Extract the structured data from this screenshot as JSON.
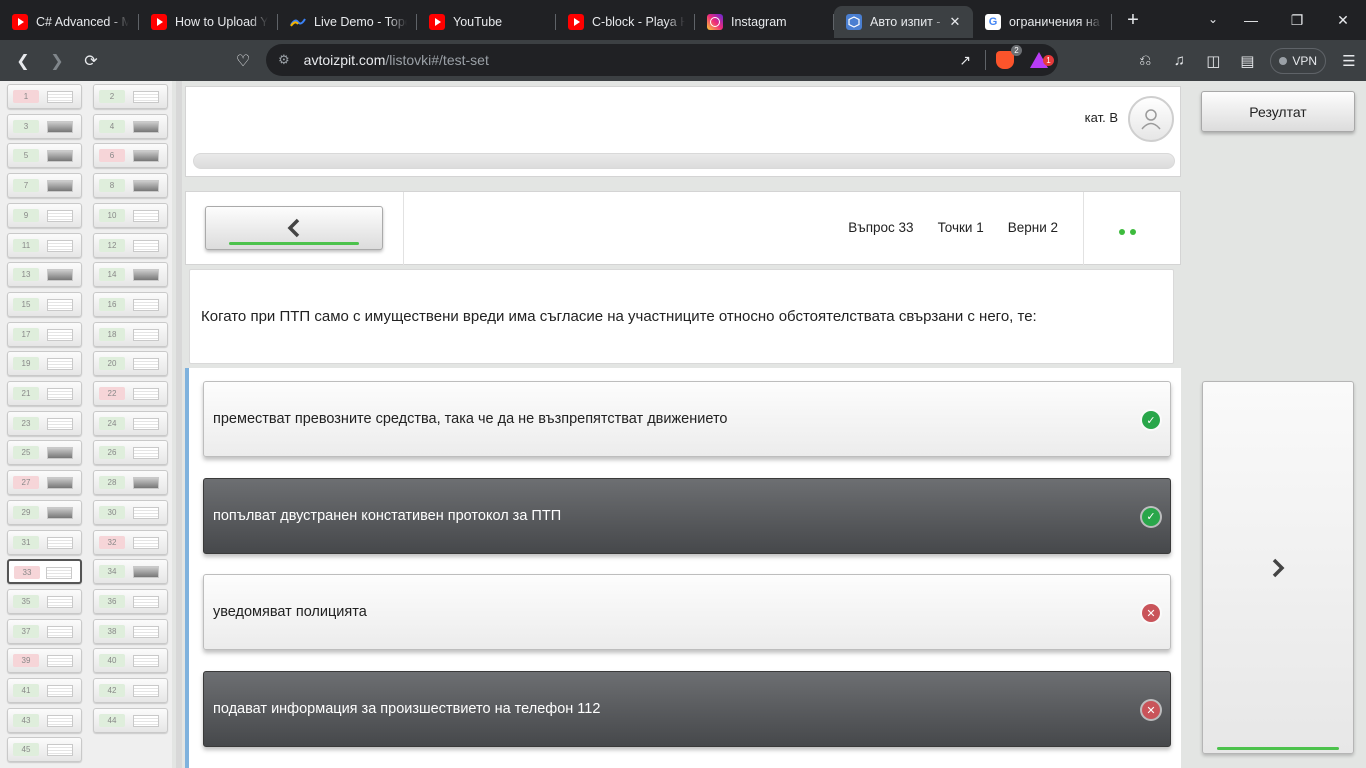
{
  "browser": {
    "tabs": [
      {
        "title": "C# Advanced - M",
        "icon": "youtube-icon"
      },
      {
        "title": "How to Upload Yo",
        "icon": "youtube-icon"
      },
      {
        "title": "Live Demo - Topo",
        "icon": "topo-icon"
      },
      {
        "title": "YouTube",
        "icon": "youtube-icon"
      },
      {
        "title": "C-block - Playa H",
        "icon": "youtube-icon"
      },
      {
        "title": "Instagram",
        "icon": "instagram-icon"
      },
      {
        "title": "Авто изпит -",
        "icon": "cube-icon",
        "active": true
      },
      {
        "title": "ограничения на с",
        "icon": "google-icon"
      }
    ],
    "url_host": "avtoizpit.com",
    "url_path": "/listovki#/test-set",
    "brave_badge": "2",
    "rewards_badge": "1",
    "vpn_label": "VPN"
  },
  "quiz": {
    "category": "кат. В",
    "result_label": "Резултат",
    "question_label": "Въпрос 33",
    "points_label": "Точки 1",
    "correct_label": "Верни 2",
    "question_text": "Когато при ПТП само с имуществени вреди има съгласие на участниците относно обстоятелствата свързани с него, те:",
    "answers": [
      {
        "text": "преместват превозните средства, така че да не възпрепятстват движението",
        "selected": false,
        "correct": true
      },
      {
        "text": "попълват двустранен констативен протокол за ПТП",
        "selected": true,
        "correct": true
      },
      {
        "text": "уведомяват полицията",
        "selected": false,
        "correct": false
      },
      {
        "text": "подават информация за произшествието на телефон 112",
        "selected": true,
        "correct": false
      }
    ]
  },
  "question_nav": [
    {
      "n": "1",
      "state": "wrong"
    },
    {
      "n": "2",
      "state": "ok"
    },
    {
      "n": "3",
      "state": "ok",
      "pic": true
    },
    {
      "n": "4",
      "state": "ok",
      "pic": true
    },
    {
      "n": "5",
      "state": "ok",
      "pic": true
    },
    {
      "n": "6",
      "state": "wrong",
      "pic": true
    },
    {
      "n": "7",
      "state": "ok",
      "pic": true
    },
    {
      "n": "8",
      "state": "ok",
      "pic": true
    },
    {
      "n": "9",
      "state": "ok"
    },
    {
      "n": "10",
      "state": "ok"
    },
    {
      "n": "11",
      "state": "ok"
    },
    {
      "n": "12",
      "state": "ok"
    },
    {
      "n": "13",
      "state": "ok",
      "pic": true
    },
    {
      "n": "14",
      "state": "ok",
      "pic": true
    },
    {
      "n": "15",
      "state": "ok"
    },
    {
      "n": "16",
      "state": "ok"
    },
    {
      "n": "17",
      "state": "ok"
    },
    {
      "n": "18",
      "state": "ok"
    },
    {
      "n": "19",
      "state": "ok"
    },
    {
      "n": "20",
      "state": "ok"
    },
    {
      "n": "21",
      "state": "ok"
    },
    {
      "n": "22",
      "state": "wrong"
    },
    {
      "n": "23",
      "state": "ok"
    },
    {
      "n": "24",
      "state": "ok"
    },
    {
      "n": "25",
      "state": "ok",
      "pic": true
    },
    {
      "n": "26",
      "state": "ok"
    },
    {
      "n": "27",
      "state": "wrong",
      "pic": true
    },
    {
      "n": "28",
      "state": "ok",
      "pic": true
    },
    {
      "n": "29",
      "state": "ok",
      "pic": true
    },
    {
      "n": "30",
      "state": "ok"
    },
    {
      "n": "31",
      "state": "ok"
    },
    {
      "n": "32",
      "state": "wrong"
    },
    {
      "n": "33",
      "state": "wrong",
      "current": true
    },
    {
      "n": "34",
      "state": "ok",
      "pic": true
    },
    {
      "n": "35",
      "state": "ok"
    },
    {
      "n": "36",
      "state": "ok"
    },
    {
      "n": "37",
      "state": "ok"
    },
    {
      "n": "38",
      "state": "ok"
    },
    {
      "n": "39",
      "state": "wrong"
    },
    {
      "n": "40",
      "state": "ok"
    },
    {
      "n": "41",
      "state": "ok"
    },
    {
      "n": "42",
      "state": "ok"
    },
    {
      "n": "43",
      "state": "ok"
    },
    {
      "n": "44",
      "state": "ok"
    },
    {
      "n": "45",
      "state": "ok"
    }
  ]
}
